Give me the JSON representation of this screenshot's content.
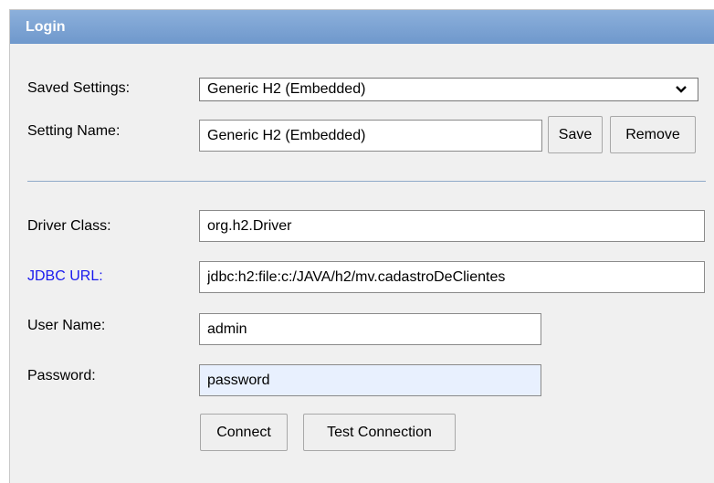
{
  "header": {
    "title": "Login"
  },
  "settings": {
    "saved_settings_label": "Saved Settings:",
    "saved_settings_value": "Generic H2 (Embedded)",
    "setting_name_label": "Setting Name:",
    "setting_name_value": "Generic H2 (Embedded)",
    "save_button": "Save",
    "remove_button": "Remove"
  },
  "connection": {
    "driver_class_label": "Driver Class:",
    "driver_class_value": "org.h2.Driver",
    "jdbc_url_label": "JDBC URL:",
    "jdbc_url_value": "jdbc:h2:file:c:/JAVA/h2/mv.cadastroDeClientes",
    "user_name_label": "User Name:",
    "user_name_value": "admin",
    "password_label": "Password:",
    "password_value": "password"
  },
  "actions": {
    "connect_button": "Connect",
    "test_connection_button": "Test Connection"
  },
  "colors": {
    "header_gradient_top": "#8cb0db",
    "header_gradient_bottom": "#6f98cc",
    "panel_background": "#f0f0f0",
    "link_label": "#1a1aee",
    "autofill_background": "#e8f0fe"
  }
}
